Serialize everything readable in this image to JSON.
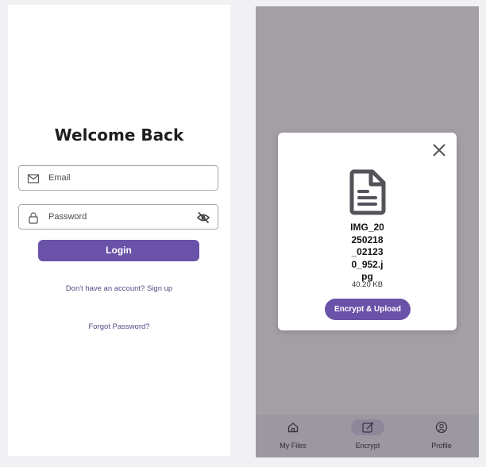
{
  "login": {
    "title": "Welcome Back",
    "email_placeholder": "Email",
    "password_placeholder": "Password",
    "login_label": "Login",
    "signup_link": "Don't have an account? Sign up",
    "forgot_link": "Forgot Password?"
  },
  "dialog": {
    "filename_lines": [
      "IMG_20",
      "250218",
      "_02123",
      "0_952.j",
      "pg"
    ],
    "filesize": "40.20 KB",
    "upload_label": "Encrypt & Upload"
  },
  "nav": {
    "items": [
      {
        "label": "My Files",
        "icon": "home-icon"
      },
      {
        "label": "Encrypt",
        "icon": "edit-icon",
        "active": true
      },
      {
        "label": "Profile",
        "icon": "profile-icon"
      }
    ]
  },
  "colors": {
    "accent": "#6a52a8",
    "scrim": "#a39fa4"
  }
}
